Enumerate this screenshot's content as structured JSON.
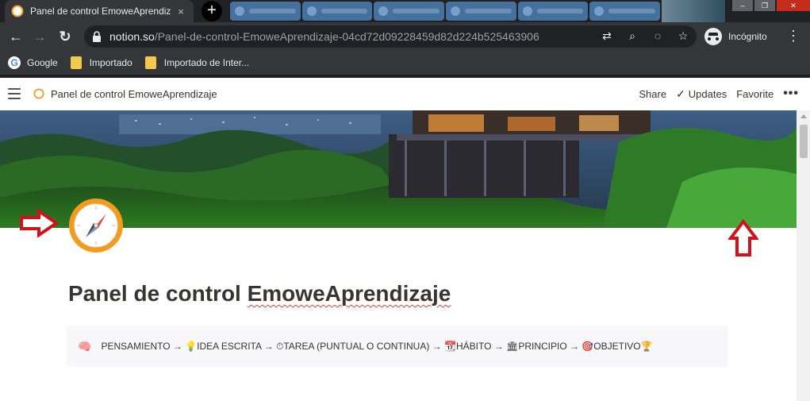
{
  "browser": {
    "active_tab": {
      "title": "Panel de control EmoweAprendiz",
      "close": "×"
    },
    "new_tab_label": "+",
    "window_controls": {
      "minimize": "–",
      "maximize": "❐",
      "close": "✕"
    },
    "nav": {
      "back": "←",
      "forward": "→",
      "reload": "↻"
    },
    "url": {
      "domain": "notion.so",
      "path": "/Panel-de-control-EmoweAprendizaje-04cd72d09228459d82d224b525463906"
    },
    "omnibox_icons": [
      {
        "name": "translate-icon",
        "glyph": "⇄"
      },
      {
        "name": "zoom-icon",
        "glyph": "⌕"
      },
      {
        "name": "eye-off-icon",
        "glyph": "◌"
      },
      {
        "name": "star-icon",
        "glyph": "☆"
      }
    ],
    "incognito_label": "Incógnito",
    "menu_glyph": "⋮",
    "bookmarks": [
      {
        "label": "Google",
        "icon": "google-icon"
      },
      {
        "label": "Importado",
        "icon": "folder-icon"
      },
      {
        "label": "Importado de Inter...",
        "icon": "folder-icon"
      }
    ]
  },
  "notion": {
    "breadcrumb_title": "Panel de control EmoweAprendizaje",
    "actions": {
      "share": "Share",
      "updates": "Updates",
      "favorite": "Favorite",
      "more": "•••"
    },
    "page": {
      "title_part1": "Panel de control ",
      "title_part2": "EmoweAprendizaje",
      "icon": "compass-icon"
    },
    "callout": {
      "icon": "🧠",
      "text": "PENSAMIENTO → 💡IDEA ESCRITA → ⏱TAREA (PUNTUAL O CONTINUA) → 📆HÁBITO → 🏛PRINCIPIO → 🎯OBJETIVO🏆"
    }
  },
  "colors": {
    "chrome_dark": "#202124",
    "chrome_toolbar": "#35363a",
    "annotation_red": "#d0121b",
    "notion_text": "#37352f",
    "compass_orange": "#f29b1d"
  }
}
